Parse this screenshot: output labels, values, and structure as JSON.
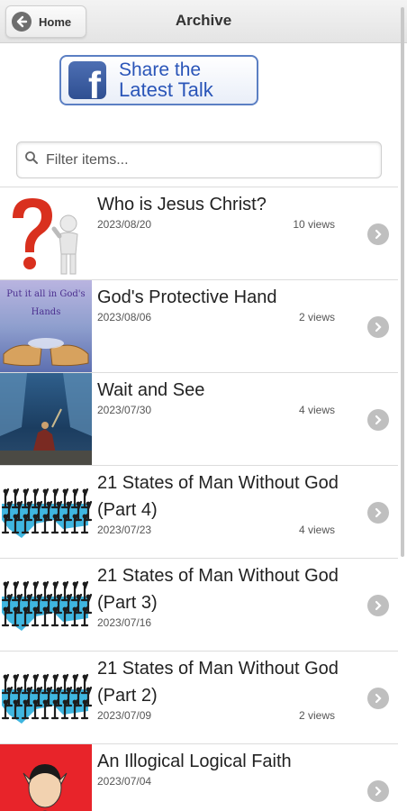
{
  "header": {
    "home_label": "Home",
    "title": "Archive"
  },
  "share": {
    "line1": "Share the",
    "line2": "Latest Talk",
    "brand_color": "#3b5998"
  },
  "filter": {
    "placeholder": "Filter items...",
    "value": ""
  },
  "items": [
    {
      "title": "Who is Jesus Christ?",
      "date": "2023/08/20",
      "views": "10 views",
      "thumb_caption": ""
    },
    {
      "title": "God's Protective Hand",
      "date": "2023/08/06",
      "views": "2 views",
      "thumb_caption": "Put it all in God's Hands"
    },
    {
      "title": "Wait and See",
      "date": "2023/07/30",
      "views": "4 views",
      "thumb_caption": ""
    },
    {
      "title": "21 States of Man Without God (Part 4)",
      "date": "2023/07/23",
      "views": "4 views",
      "thumb_caption": ""
    },
    {
      "title": "21 States of Man Without God (Part 3)",
      "date": "2023/07/16",
      "views": "",
      "thumb_caption": ""
    },
    {
      "title": "21 States of Man Without God (Part 2)",
      "date": "2023/07/09",
      "views": "2 views",
      "thumb_caption": ""
    },
    {
      "title": "An Illogical Logical Faith",
      "date": "2023/07/04",
      "views": "",
      "thumb_caption": ""
    }
  ]
}
